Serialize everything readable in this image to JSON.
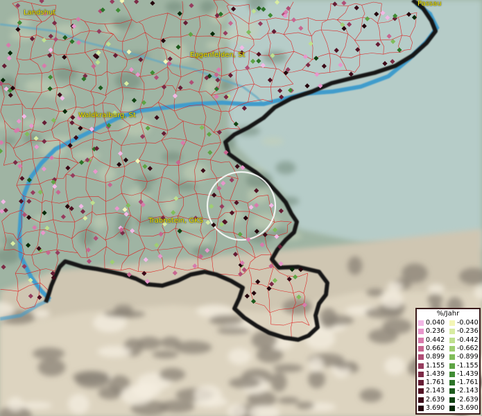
{
  "map": {
    "towns": [
      {
        "label": "Landshut"
      },
      {
        "label": "Passau"
      },
      {
        "label": "Eggenfelden, St"
      },
      {
        "label": "Waldkraiburg, St"
      },
      {
        "label": "Trabnstein, GKS"
      }
    ],
    "legend": {
      "title": "%/Jahr",
      "positive": [
        {
          "value": "0.040",
          "color": "#f2b8e6"
        },
        {
          "value": "0.236",
          "color": "#e896cc"
        },
        {
          "value": "0.442",
          "color": "#d87aac"
        },
        {
          "value": "0.662",
          "color": "#c76690"
        },
        {
          "value": "0.899",
          "color": "#b04e76"
        },
        {
          "value": "1.155",
          "color": "#963c5e"
        },
        {
          "value": "1.439",
          "color": "#7c2a46"
        },
        {
          "value": "1.761",
          "color": "#661c34"
        },
        {
          "value": "2.143",
          "color": "#521224"
        },
        {
          "value": "2.639",
          "color": "#3c0a18"
        },
        {
          "value": "3.690",
          "color": "#24040c"
        }
      ],
      "negative": [
        {
          "value": "-0.040",
          "color": "#f4f6b6"
        },
        {
          "value": "-0.236",
          "color": "#d8eca2"
        },
        {
          "value": "-0.442",
          "color": "#bfe08e"
        },
        {
          "value": "-0.662",
          "color": "#9fce72"
        },
        {
          "value": "-0.899",
          "color": "#80bc5a"
        },
        {
          "value": "-1.155",
          "color": "#5ea444"
        },
        {
          "value": "-1.439",
          "color": "#408c34"
        },
        {
          "value": "-1.761",
          "color": "#2c7428"
        },
        {
          "value": "-2.143",
          "color": "#1c5a1c"
        },
        {
          "value": "-2.639",
          "color": "#104212"
        },
        {
          "value": "-3.690",
          "color": "#062a08"
        }
      ]
    },
    "colors": {
      "boundary": "#e01818",
      "river": "#4aa6cf",
      "border": "#1a1a1a",
      "lowland": "#a0b6a4",
      "austria": "#b4cac6",
      "alps": "#ddd2bc"
    }
  }
}
